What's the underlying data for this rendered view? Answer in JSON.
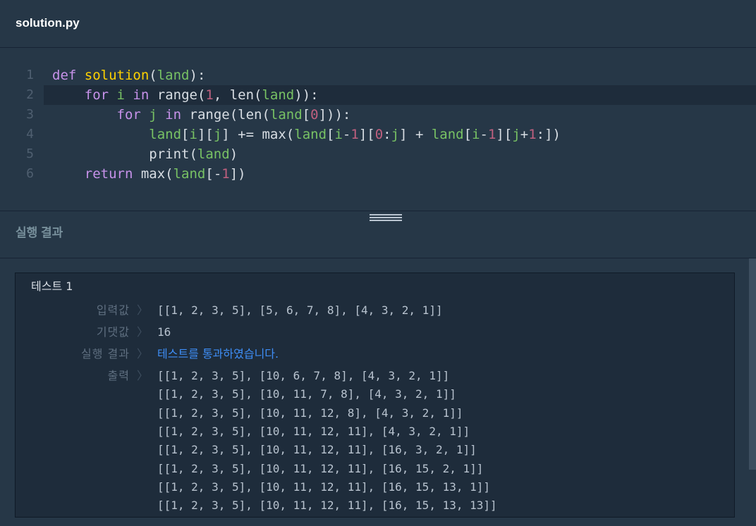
{
  "file": {
    "name": "solution.py"
  },
  "editor": {
    "line_numbers": [
      "1",
      "2",
      "3",
      "4",
      "5",
      "6"
    ],
    "active_line": 2,
    "lines": [
      [
        {
          "t": "def ",
          "c": "kw"
        },
        {
          "t": "solution",
          "c": "fn"
        },
        {
          "t": "(",
          "c": "pl"
        },
        {
          "t": "land",
          "c": "var"
        },
        {
          "t": "):",
          "c": "pl"
        }
      ],
      [
        {
          "t": "    ",
          "c": "pl"
        },
        {
          "t": "for ",
          "c": "kw"
        },
        {
          "t": "i",
          "c": "var"
        },
        {
          "t": " in ",
          "c": "kw"
        },
        {
          "t": "range(",
          "c": "pl"
        },
        {
          "t": "1",
          "c": "num"
        },
        {
          "t": ", len(",
          "c": "pl"
        },
        {
          "t": "land",
          "c": "var"
        },
        {
          "t": ")):",
          "c": "pl"
        }
      ],
      [
        {
          "t": "        ",
          "c": "pl"
        },
        {
          "t": "for ",
          "c": "kw"
        },
        {
          "t": "j",
          "c": "var"
        },
        {
          "t": " in ",
          "c": "kw"
        },
        {
          "t": "range(len(",
          "c": "pl"
        },
        {
          "t": "land",
          "c": "var"
        },
        {
          "t": "[",
          "c": "pl"
        },
        {
          "t": "0",
          "c": "num"
        },
        {
          "t": "])):",
          "c": "pl"
        }
      ],
      [
        {
          "t": "            ",
          "c": "pl"
        },
        {
          "t": "land",
          "c": "var"
        },
        {
          "t": "[",
          "c": "pl"
        },
        {
          "t": "i",
          "c": "var"
        },
        {
          "t": "][",
          "c": "pl"
        },
        {
          "t": "j",
          "c": "var"
        },
        {
          "t": "] += max(",
          "c": "pl"
        },
        {
          "t": "land",
          "c": "var"
        },
        {
          "t": "[",
          "c": "pl"
        },
        {
          "t": "i",
          "c": "var"
        },
        {
          "t": "-",
          "c": "pl"
        },
        {
          "t": "1",
          "c": "num"
        },
        {
          "t": "][",
          "c": "pl"
        },
        {
          "t": "0",
          "c": "num"
        },
        {
          "t": ":",
          "c": "pl"
        },
        {
          "t": "j",
          "c": "var"
        },
        {
          "t": "] + ",
          "c": "pl"
        },
        {
          "t": "land",
          "c": "var"
        },
        {
          "t": "[",
          "c": "pl"
        },
        {
          "t": "i",
          "c": "var"
        },
        {
          "t": "-",
          "c": "pl"
        },
        {
          "t": "1",
          "c": "num"
        },
        {
          "t": "][",
          "c": "pl"
        },
        {
          "t": "j",
          "c": "var"
        },
        {
          "t": "+",
          "c": "pl"
        },
        {
          "t": "1",
          "c": "num"
        },
        {
          "t": ":])",
          "c": "pl"
        }
      ],
      [
        {
          "t": "            ",
          "c": "pl"
        },
        {
          "t": "print(",
          "c": "pl"
        },
        {
          "t": "land",
          "c": "var"
        },
        {
          "t": ")",
          "c": "pl"
        }
      ],
      [
        {
          "t": "    ",
          "c": "pl"
        },
        {
          "t": "return ",
          "c": "kw"
        },
        {
          "t": "max(",
          "c": "pl"
        },
        {
          "t": "land",
          "c": "var"
        },
        {
          "t": "[-",
          "c": "pl"
        },
        {
          "t": "1",
          "c": "num"
        },
        {
          "t": "])",
          "c": "pl"
        }
      ]
    ]
  },
  "results": {
    "title": "실행 결과",
    "test": {
      "title": "테스트 1",
      "arrow": "〉",
      "input_label": "입력값",
      "input_value": "[[1, 2, 3, 5], [5, 6, 7, 8], [4, 3, 2, 1]]",
      "expected_label": "기댓값",
      "expected_value": "16",
      "result_label": "실행 결과",
      "result_value": "테스트를 통과하였습니다.",
      "output_label": "출력",
      "output_lines": [
        "[[1, 2, 3, 5], [10, 6, 7, 8], [4, 3, 2, 1]]",
        "[[1, 2, 3, 5], [10, 11, 7, 8], [4, 3, 2, 1]]",
        "[[1, 2, 3, 5], [10, 11, 12, 8], [4, 3, 2, 1]]",
        "[[1, 2, 3, 5], [10, 11, 12, 11], [4, 3, 2, 1]]",
        "[[1, 2, 3, 5], [10, 11, 12, 11], [16, 3, 2, 1]]",
        "[[1, 2, 3, 5], [10, 11, 12, 11], [16, 15, 2, 1]]",
        "[[1, 2, 3, 5], [10, 11, 12, 11], [16, 15, 13, 1]]",
        "[[1, 2, 3, 5], [10, 11, 12, 11], [16, 15, 13, 13]]"
      ]
    }
  },
  "colors": {
    "background": "#263747",
    "panel": "#1e2c3b",
    "keyword": "#c792ea",
    "function": "#ffd200",
    "variable": "#78c264",
    "number": "#c0607f",
    "pass": "#3e8ef7"
  }
}
